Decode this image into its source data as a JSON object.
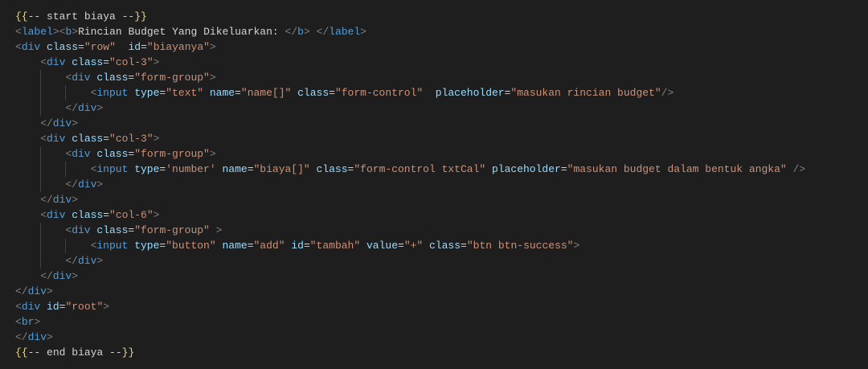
{
  "editor": {
    "theme_colors": {
      "background": "#1e1e1e",
      "punctuation": "#808080",
      "tag": "#569cd6",
      "attribute": "#9cdcfe",
      "string": "#ce9178",
      "text": "#d4d4d4"
    },
    "lines": [
      {
        "i": 0,
        "t": [
          [
            "b",
            "{{"
          ],
          [
            "x",
            "-- start biaya --"
          ],
          [
            "b",
            "}}"
          ]
        ]
      },
      {
        "i": 0,
        "t": [
          [
            "p",
            "<"
          ],
          [
            "g",
            "label"
          ],
          [
            "p",
            "><"
          ],
          [
            "g",
            "b"
          ],
          [
            "p",
            ">"
          ],
          [
            "x",
            "Rincian Budget Yang Dikeluarkan: "
          ],
          [
            "p",
            "</"
          ],
          [
            "g",
            "b"
          ],
          [
            "p",
            "> </"
          ],
          [
            "g",
            "label"
          ],
          [
            "p",
            ">"
          ]
        ]
      },
      {
        "i": 0,
        "t": [
          [
            "p",
            "<"
          ],
          [
            "g",
            "div"
          ],
          [
            "x",
            " "
          ],
          [
            "a",
            "class"
          ],
          [
            "x",
            "="
          ],
          [
            "s",
            "\"row\""
          ],
          [
            "x",
            "  "
          ],
          [
            "a",
            "id"
          ],
          [
            "x",
            "="
          ],
          [
            "s",
            "\"biayanya\""
          ],
          [
            "p",
            ">"
          ]
        ]
      },
      {
        "i": 1,
        "t": [
          [
            "p",
            "<"
          ],
          [
            "g",
            "div"
          ],
          [
            "x",
            " "
          ],
          [
            "a",
            "class"
          ],
          [
            "x",
            "="
          ],
          [
            "s",
            "\"col-3\""
          ],
          [
            "p",
            ">"
          ]
        ]
      },
      {
        "i": 2,
        "t": [
          [
            "p",
            "<"
          ],
          [
            "g",
            "div"
          ],
          [
            "x",
            " "
          ],
          [
            "a",
            "class"
          ],
          [
            "x",
            "="
          ],
          [
            "s",
            "\"form-group\""
          ],
          [
            "p",
            ">"
          ]
        ]
      },
      {
        "i": 3,
        "t": [
          [
            "p",
            "<"
          ],
          [
            "g",
            "input"
          ],
          [
            "x",
            " "
          ],
          [
            "a",
            "type"
          ],
          [
            "x",
            "="
          ],
          [
            "s",
            "\"text\""
          ],
          [
            "x",
            " "
          ],
          [
            "a",
            "name"
          ],
          [
            "x",
            "="
          ],
          [
            "s",
            "\"name[]\""
          ],
          [
            "x",
            " "
          ],
          [
            "a",
            "class"
          ],
          [
            "x",
            "="
          ],
          [
            "s",
            "\"form-control\""
          ],
          [
            "x",
            "  "
          ],
          [
            "a",
            "placeholder"
          ],
          [
            "x",
            "="
          ],
          [
            "s",
            "\"masukan rincian budget\""
          ],
          [
            "p",
            "/>"
          ]
        ]
      },
      {
        "i": 2,
        "t": [
          [
            "p",
            "</"
          ],
          [
            "g",
            "div"
          ],
          [
            "p",
            ">"
          ]
        ]
      },
      {
        "i": 1,
        "t": [
          [
            "p",
            "</"
          ],
          [
            "g",
            "div"
          ],
          [
            "p",
            ">"
          ]
        ]
      },
      {
        "i": 1,
        "t": [
          [
            "p",
            "<"
          ],
          [
            "g",
            "div"
          ],
          [
            "x",
            " "
          ],
          [
            "a",
            "class"
          ],
          [
            "x",
            "="
          ],
          [
            "s",
            "\"col-3\""
          ],
          [
            "p",
            ">"
          ]
        ]
      },
      {
        "i": 2,
        "t": [
          [
            "p",
            "<"
          ],
          [
            "g",
            "div"
          ],
          [
            "x",
            " "
          ],
          [
            "a",
            "class"
          ],
          [
            "x",
            "="
          ],
          [
            "s",
            "\"form-group\""
          ],
          [
            "p",
            ">"
          ]
        ]
      },
      {
        "i": 3,
        "t": [
          [
            "p",
            "<"
          ],
          [
            "g",
            "input"
          ],
          [
            "x",
            " "
          ],
          [
            "a",
            "type"
          ],
          [
            "x",
            "="
          ],
          [
            "s",
            "'number'"
          ],
          [
            "x",
            " "
          ],
          [
            "a",
            "name"
          ],
          [
            "x",
            "="
          ],
          [
            "s",
            "\"biaya[]\""
          ],
          [
            "x",
            " "
          ],
          [
            "a",
            "class"
          ],
          [
            "x",
            "="
          ],
          [
            "s",
            "\"form-control txtCal\""
          ],
          [
            "x",
            " "
          ],
          [
            "a",
            "placeholder"
          ],
          [
            "x",
            "="
          ],
          [
            "s",
            "\"masukan budget dalam bentuk angka\""
          ],
          [
            "x",
            " "
          ],
          [
            "p",
            "/>"
          ]
        ]
      },
      {
        "i": 2,
        "t": [
          [
            "p",
            "</"
          ],
          [
            "g",
            "div"
          ],
          [
            "p",
            ">"
          ]
        ]
      },
      {
        "i": 1,
        "t": [
          [
            "p",
            "</"
          ],
          [
            "g",
            "div"
          ],
          [
            "p",
            ">"
          ]
        ]
      },
      {
        "i": 1,
        "t": [
          [
            "p",
            "<"
          ],
          [
            "g",
            "div"
          ],
          [
            "x",
            " "
          ],
          [
            "a",
            "class"
          ],
          [
            "x",
            "="
          ],
          [
            "s",
            "\"col-6\""
          ],
          [
            "p",
            ">"
          ]
        ]
      },
      {
        "i": 2,
        "t": [
          [
            "p",
            "<"
          ],
          [
            "g",
            "div"
          ],
          [
            "x",
            " "
          ],
          [
            "a",
            "class"
          ],
          [
            "x",
            "="
          ],
          [
            "s",
            "\"form-group\""
          ],
          [
            "x",
            " "
          ],
          [
            "p",
            ">"
          ]
        ]
      },
      {
        "i": 3,
        "t": [
          [
            "p",
            "<"
          ],
          [
            "g",
            "input"
          ],
          [
            "x",
            " "
          ],
          [
            "a",
            "type"
          ],
          [
            "x",
            "="
          ],
          [
            "s",
            "\"button\""
          ],
          [
            "x",
            " "
          ],
          [
            "a",
            "name"
          ],
          [
            "x",
            "="
          ],
          [
            "s",
            "\"add\""
          ],
          [
            "x",
            " "
          ],
          [
            "a",
            "id"
          ],
          [
            "x",
            "="
          ],
          [
            "s",
            "\"tambah\""
          ],
          [
            "x",
            " "
          ],
          [
            "a",
            "value"
          ],
          [
            "x",
            "="
          ],
          [
            "s",
            "\"+\""
          ],
          [
            "x",
            " "
          ],
          [
            "a",
            "class"
          ],
          [
            "x",
            "="
          ],
          [
            "s",
            "\"btn btn-success\""
          ],
          [
            "p",
            ">"
          ]
        ]
      },
      {
        "i": 2,
        "t": [
          [
            "p",
            "</"
          ],
          [
            "g",
            "div"
          ],
          [
            "p",
            ">"
          ]
        ]
      },
      {
        "i": 1,
        "t": [
          [
            "p",
            "</"
          ],
          [
            "g",
            "div"
          ],
          [
            "p",
            ">"
          ]
        ]
      },
      {
        "i": 0,
        "t": [
          [
            "p",
            "</"
          ],
          [
            "g",
            "div"
          ],
          [
            "p",
            ">"
          ]
        ]
      },
      {
        "i": 0,
        "t": [
          [
            "p",
            "<"
          ],
          [
            "g",
            "div"
          ],
          [
            "x",
            " "
          ],
          [
            "a",
            "id"
          ],
          [
            "x",
            "="
          ],
          [
            "s",
            "\"root\""
          ],
          [
            "p",
            ">"
          ]
        ]
      },
      {
        "i": 0,
        "t": [
          [
            "p",
            "<"
          ],
          [
            "g",
            "br"
          ],
          [
            "p",
            ">"
          ]
        ]
      },
      {
        "i": 0,
        "t": [
          [
            "p",
            "</"
          ],
          [
            "g",
            "div"
          ],
          [
            "p",
            ">"
          ]
        ]
      },
      {
        "i": 0,
        "t": [
          [
            "b",
            "{{"
          ],
          [
            "x",
            "-- end biaya --"
          ],
          [
            "b",
            "}}"
          ]
        ]
      }
    ]
  }
}
